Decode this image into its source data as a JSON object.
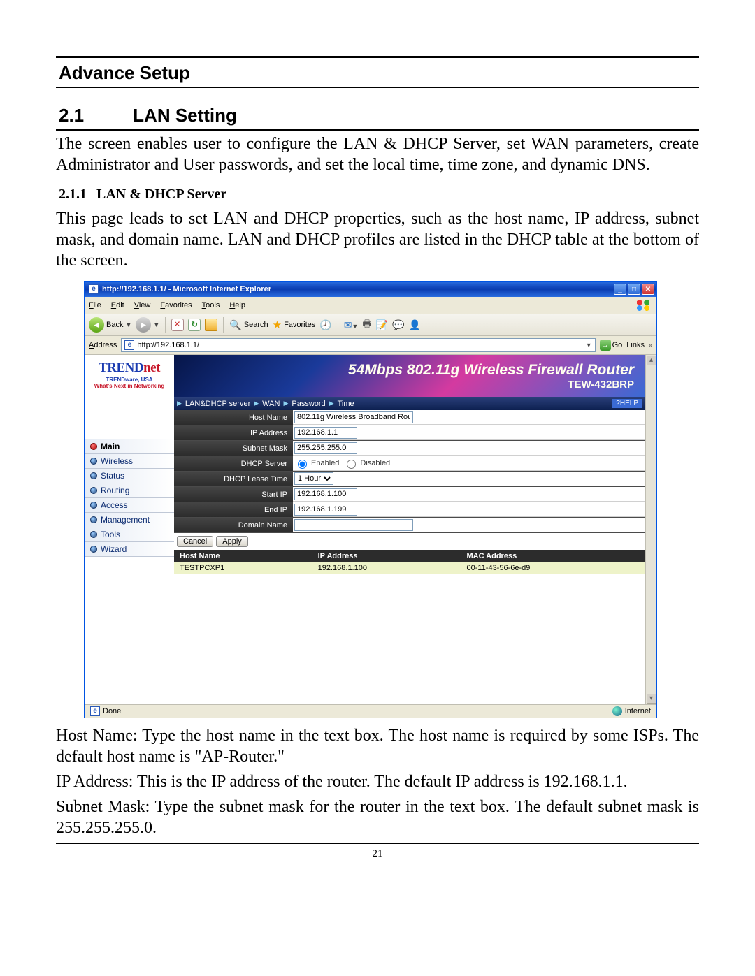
{
  "doc": {
    "chapter": "Advance Setup",
    "h2_num": "2.1",
    "h2_title": "LAN Setting",
    "p1": "The screen enables user to configure the LAN & DHCP Server, set WAN parameters, create Administrator and User passwords, and set the local time, time zone, and dynamic DNS.",
    "h3_num": "2.1.1",
    "h3_title": "LAN & DHCP Server",
    "p2": "This page leads to set LAN and DHCP properties, such as the host name, IP address, subnet mask, and domain name. LAN and DHCP profiles are listed in the DHCP table at the bottom of the screen.",
    "p3": "Host Name: Type the host name in the text box. The host name is required by some ISPs. The default host name is \"AP-Router.\"",
    "p4": "IP Address: This is the IP address of the router. The default IP address is 192.168.1.1.",
    "p5": "Subnet Mask: Type the subnet mask for the router in the text box. The default subnet mask is 255.255.255.0.",
    "page_num": "21"
  },
  "ie": {
    "title": "http://192.168.1.1/ - Microsoft Internet Explorer",
    "menu": [
      "File",
      "Edit",
      "View",
      "Favorites",
      "Tools",
      "Help"
    ],
    "back": "Back",
    "search": "Search",
    "favorites": "Favorites",
    "addr_label": "Address",
    "url": "http://192.168.1.1/",
    "go": "Go",
    "links": "Links",
    "status": "Done",
    "zone": "Internet"
  },
  "brand": {
    "name1": "TREND",
    "name2": "net",
    "sub1": "TRENDware, USA",
    "sub2": "What's Next in Networking"
  },
  "banner": {
    "t1": "54Mbps 802.11g Wireless Firewall Router",
    "t2": "TEW-432BRP"
  },
  "sidenav": [
    {
      "label": "Main",
      "active": true
    },
    {
      "label": "Wireless",
      "active": false
    },
    {
      "label": "Status",
      "active": false
    },
    {
      "label": "Routing",
      "active": false
    },
    {
      "label": "Access",
      "active": false
    },
    {
      "label": "Management",
      "active": false
    },
    {
      "label": "Tools",
      "active": false
    },
    {
      "label": "Wizard",
      "active": false
    }
  ],
  "tabs": {
    "t1": "LAN&DHCP server",
    "t2": "WAN",
    "t3": "Password",
    "t4": "Time",
    "help": "HELP"
  },
  "form": {
    "host_name_lab": "Host Name",
    "host_name": "802.11g Wireless Broadband Rou",
    "ip_lab": "IP Address",
    "ip": "192.168.1.1",
    "mask_lab": "Subnet Mask",
    "mask": "255.255.255.0",
    "dhcp_lab": "DHCP Server",
    "enabled": "Enabled",
    "disabled": "Disabled",
    "lease_lab": "DHCP Lease Time",
    "lease": "1 Hour",
    "start_lab": "Start IP",
    "start": "192.168.1.100",
    "end_lab": "End IP",
    "end": "192.168.1.199",
    "domain_lab": "Domain Name",
    "domain": "",
    "cancel": "Cancel",
    "apply": "Apply"
  },
  "clients": {
    "cols": [
      "Host Name",
      "IP Address",
      "MAC Address"
    ],
    "rows": [
      {
        "host": "TESTPCXP1",
        "ip": "192.168.1.100",
        "mac": "00-11-43-56-6e-d9"
      }
    ]
  }
}
